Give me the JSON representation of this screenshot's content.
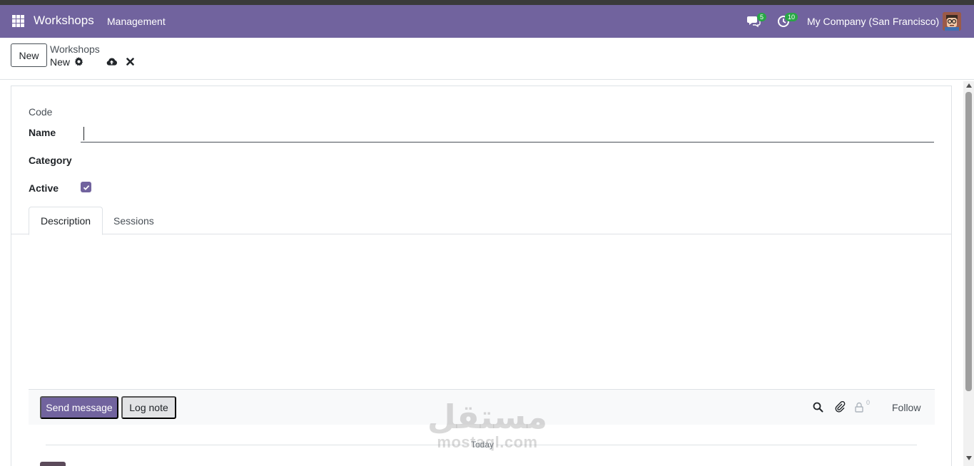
{
  "navbar": {
    "brand": "Workshops",
    "menu": [
      "Management"
    ],
    "messages_badge": "5",
    "activities_badge": "10",
    "company": "My Company (San Francisco)",
    "accent_color": "#71639e"
  },
  "control_panel": {
    "new_button": "New",
    "breadcrumb_parent": "Workshops",
    "breadcrumb_current": "New",
    "icons": [
      "gear-icon",
      "cloud-upload-icon",
      "close-icon"
    ]
  },
  "form": {
    "code_label": "Code",
    "name_label": "Name",
    "name_value": "",
    "category_label": "Category",
    "active_label": "Active",
    "active_checked": true
  },
  "tabs": [
    {
      "label": "Description",
      "active": true
    },
    {
      "label": "Sessions",
      "active": false
    }
  ],
  "chatter": {
    "send_message": "Send message",
    "log_note": "Log note",
    "followers_count": "0",
    "follow": "Follow",
    "date_separator": "Today"
  },
  "watermark": {
    "arabic": "مستقل",
    "latin": "mostaql.com"
  }
}
